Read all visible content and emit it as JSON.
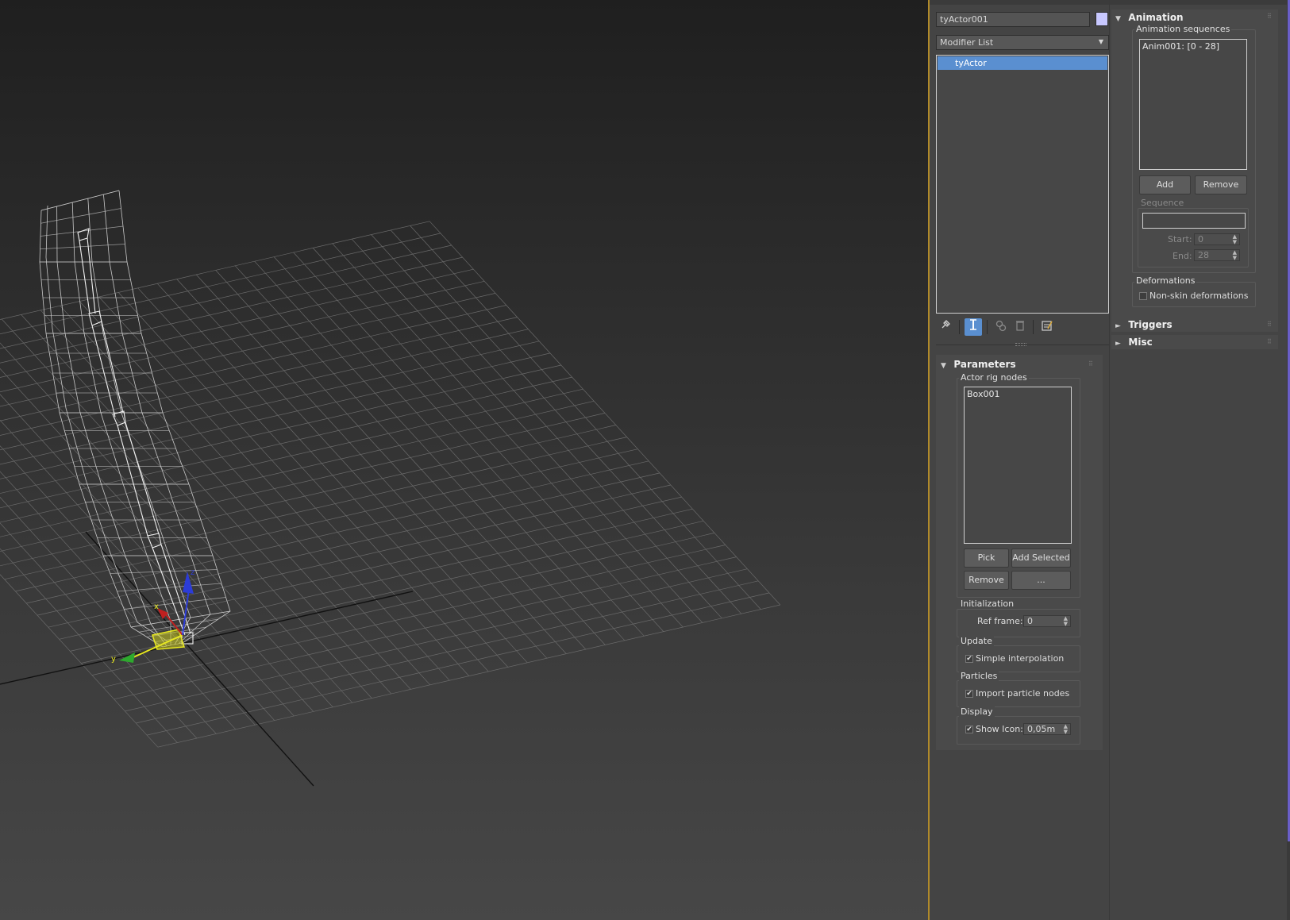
{
  "viewport": {
    "gizmo_axes": {
      "x": "x",
      "y": "y",
      "z": "z"
    }
  },
  "object_name": {
    "value": "tyActor001",
    "color": "#c8c8ff"
  },
  "modifier_list": {
    "label": "Modifier List",
    "arrow": "▼"
  },
  "modifier_stack": {
    "items": [
      {
        "label": "tyActor",
        "selected": true
      }
    ]
  },
  "stack_toolbar": {
    "icons": [
      "pin-stack-icon",
      "show-end-result-icon",
      "make-unique-icon",
      "remove-modifier-icon",
      "configure-modifier-sets-icon"
    ]
  },
  "parameters": {
    "title": "Parameters",
    "actor_rig_nodes": {
      "label": "Actor rig nodes",
      "items": [
        "Box001"
      ],
      "pick": "Pick",
      "add_selected": "Add Selected",
      "remove": "Remove",
      "more": "..."
    },
    "initialization": {
      "label": "Initialization",
      "ref_frame_label": "Ref frame:",
      "ref_frame_value": "0"
    },
    "update": {
      "label": "Update",
      "simple_interpolation": "Simple interpolation",
      "simple_interpolation_checked": true
    },
    "particles": {
      "label": "Particles",
      "import_particle_nodes": "Import particle nodes",
      "import_checked": true
    },
    "display": {
      "label": "Display",
      "show_icon_label": "Show Icon:",
      "show_icon_checked": true,
      "icon_size": "0,05m"
    }
  },
  "animation": {
    "title": "Animation",
    "sequences_label": "Animation sequences",
    "sequences": [
      "Anim001: [0 - 28]"
    ],
    "add": "Add",
    "remove": "Remove",
    "sequence_group": {
      "label": "Sequence",
      "name_value": "",
      "start_label": "Start:",
      "start_value": "0",
      "end_label": "End:",
      "end_value": "28"
    },
    "deformations": {
      "label": "Deformations",
      "non_skin": "Non-skin deformations",
      "non_skin_checked": false
    }
  },
  "triggers": {
    "title": "Triggers"
  },
  "misc": {
    "title": "Misc"
  }
}
